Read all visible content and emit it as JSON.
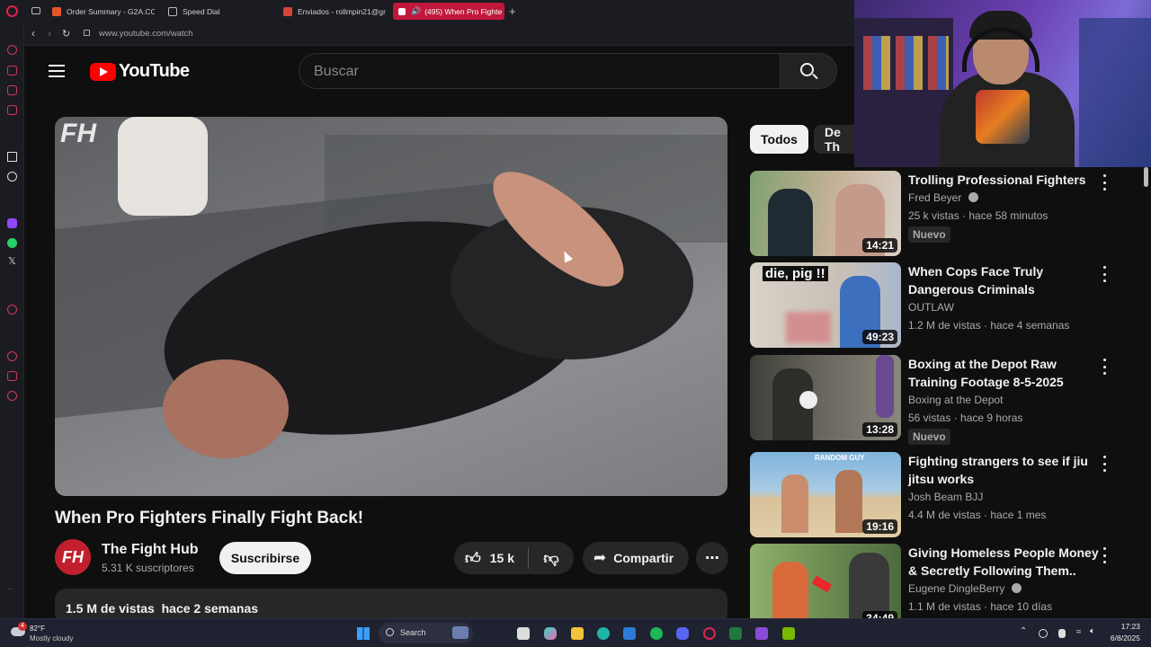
{
  "browser": {
    "tabs": [
      {
        "label": "Order Summary - G2A.CO",
        "color": "#e8542a"
      },
      {
        "label": "Speed Dial",
        "color": "#bbbbbb"
      },
      {
        "label": "Enviados - rollmpin21@gm",
        "color": "#d44638"
      },
      {
        "label": "(495) When Pro Fighte",
        "color": "#ffffff"
      }
    ],
    "url": "www.youtube.com/watch"
  },
  "header": {
    "logo_text": "YouTube",
    "search_placeholder": "Buscar"
  },
  "video": {
    "title": "When Pro Fighters Finally Fight Back!",
    "watermark": "FH",
    "channel": {
      "avatar_text": "FH",
      "name": "The Fight Hub",
      "subscribers": "5.31 K suscriptores"
    },
    "subscribe_label": "Suscribirse",
    "likes": "15 k",
    "share_label": "Compartir",
    "description_meta": "1.5 M de vistas  hace 2 semanas"
  },
  "chips": [
    {
      "label": "Todos",
      "active": true
    },
    {
      "label": "De Th",
      "active": false
    }
  ],
  "recommendations": [
    {
      "title": "Trolling Professional Fighters",
      "channel": "Fred Beyer",
      "verified": true,
      "views": "25 k vistas",
      "age": "hace 58 minutos",
      "badge": "Nuevo",
      "duration": "14:21",
      "thumb_colors": [
        "#8aa27a",
        "#c9b6a0"
      ]
    },
    {
      "title": "When Cops Face Truly Dangerous Criminals",
      "channel": "OUTLAW",
      "verified": false,
      "views": "1.2 M de vistas",
      "age": "hace 4 semanas",
      "badge": "",
      "duration": "49:23",
      "thumb_colors": [
        "#d9d2c8",
        "#6a8fc4"
      ],
      "thumb_text": "die, pig !!"
    },
    {
      "title": "Boxing at the Depot Raw Training Footage 8-5-2025",
      "channel": "Boxing at the Depot",
      "verified": false,
      "views": "56 vistas",
      "age": "hace 9 horas",
      "badge": "Nuevo",
      "duration": "13:28",
      "thumb_colors": [
        "#4a4a44",
        "#8c8a80"
      ]
    },
    {
      "title": "Fighting strangers to see if jiu jitsu works",
      "channel": "Josh Beam BJJ",
      "verified": false,
      "views": "4.4 M de vistas",
      "age": "hace 1 mes",
      "badge": "",
      "duration": "19:16",
      "thumb_colors": [
        "#7fb4dc",
        "#d9c29a"
      ],
      "thumb_text": "RANDOM GUY"
    },
    {
      "title": "Giving Homeless People Money & Secretly Following Them..",
      "channel": "Eugene DingleBerry",
      "verified": true,
      "views": "1.1 M de vistas",
      "age": "hace 10 días",
      "badge": "",
      "duration": "34:49",
      "thumb_colors": [
        "#9bb872",
        "#4d6a3e"
      ]
    }
  ],
  "taskbar": {
    "weather_temp": "82°F",
    "weather_desc": "Mostly cloudy",
    "weather_badge": "4",
    "search_label": "Search",
    "time": "17:23",
    "date": "6/8/2025"
  }
}
